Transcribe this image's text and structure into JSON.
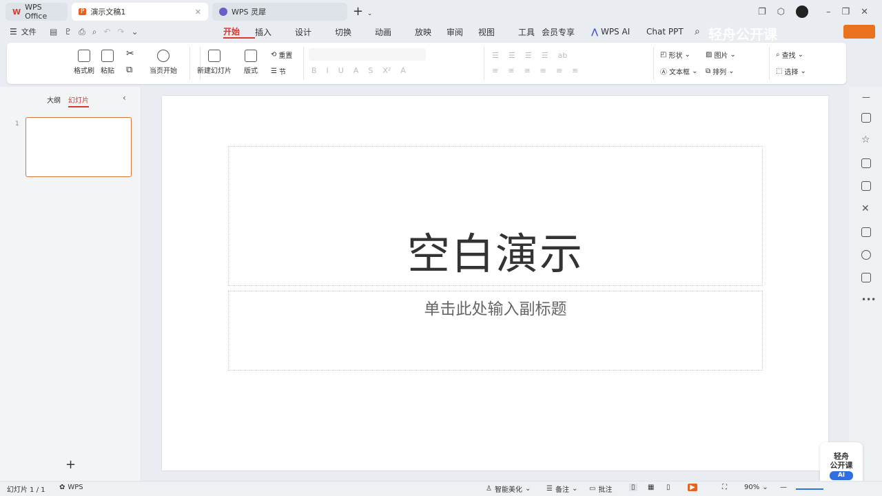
{
  "tabs": [
    {
      "label": "WPS Office",
      "icon": "wps-logo-icon"
    },
    {
      "label": "演示文稿1",
      "icon": "presentation-icon",
      "active": true
    },
    {
      "label": "WPS 灵犀",
      "icon": "lingxi-icon"
    }
  ],
  "menu": {
    "file": "文件",
    "tabs": [
      "开始",
      "插入",
      "设计",
      "切换",
      "动画",
      "放映",
      "审阅",
      "视图",
      "工具",
      "会员专享"
    ],
    "active": "开始",
    "wps_ai": "WPS AI",
    "chat_ppt": "Chat PPT",
    "watermark": "轻舟公开课"
  },
  "ribbon": {
    "format_painter": "格式刷",
    "paste": "粘贴",
    "play_from_current": "当页开始",
    "new_slide": "新建幻灯片",
    "layout": "版式",
    "reset": "重置",
    "section": "节",
    "shape": "形状",
    "picture": "图片",
    "textbox": "文本框",
    "arrange": "排列",
    "find": "查找",
    "select": "选择"
  },
  "panel": {
    "outline": "大纲",
    "slides": "幻灯片",
    "slide_number": "1"
  },
  "slide": {
    "title": "空白演示",
    "subtitle": "单击此处输入副标题"
  },
  "status": {
    "slide_count": "幻灯片 1 / 1",
    "wps": "WPS",
    "beautify": "智能美化",
    "notes": "备注",
    "comments": "批注",
    "zoom": "90%"
  },
  "badge": {
    "line1": "轻舟",
    "line2": "公开课",
    "ai": "AI"
  },
  "colors": {
    "accent": "#e0562c",
    "bg": "#e9edf1"
  }
}
